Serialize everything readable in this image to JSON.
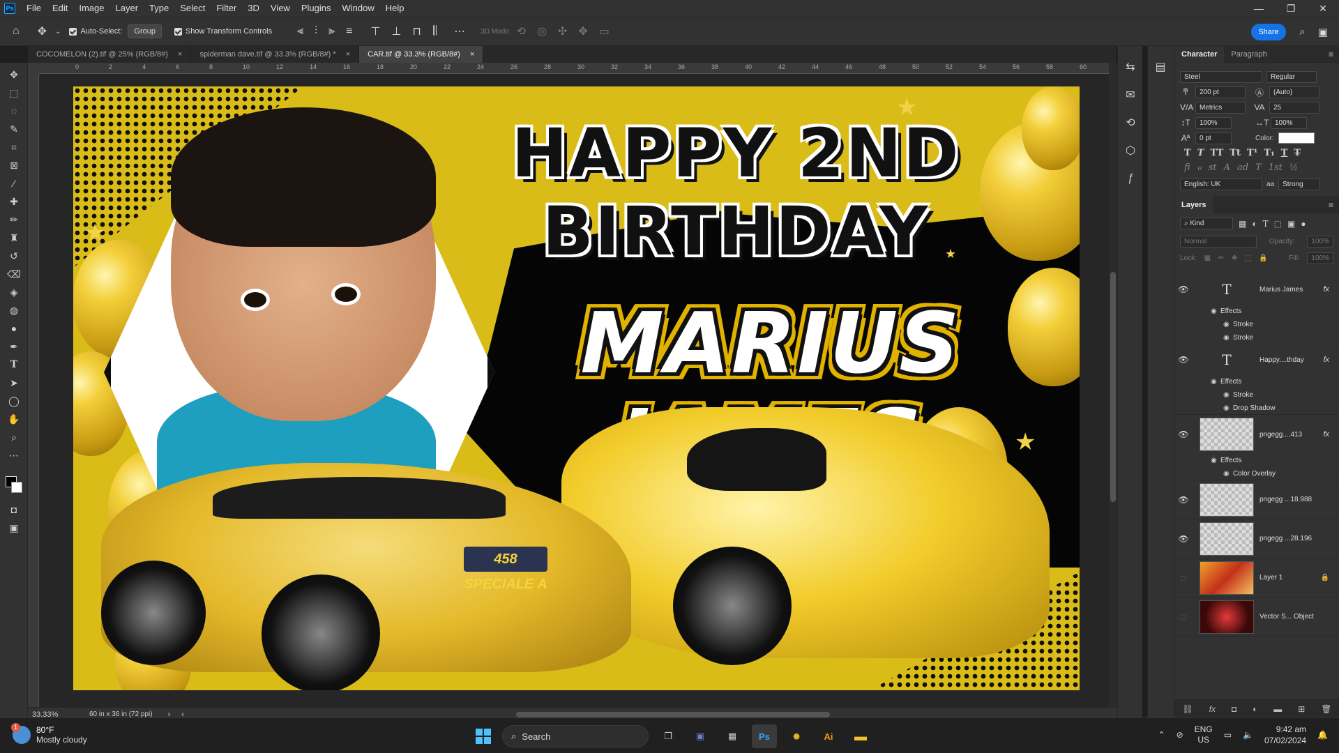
{
  "app": {
    "menu": [
      "File",
      "Edit",
      "Image",
      "Layer",
      "Type",
      "Select",
      "Filter",
      "3D",
      "View",
      "Plugins",
      "Window",
      "Help"
    ],
    "window_controls": [
      "—",
      "❐",
      "✕"
    ]
  },
  "options_bar": {
    "auto_select_label": "Auto-Select:",
    "auto_select_value": "Group",
    "show_transform_label": "Show Transform Controls",
    "mode_3d": "3D Mode:",
    "share_label": "Share"
  },
  "tabs": [
    {
      "label": "COCOMELON (2).tif @ 25% (RGB/8#)",
      "close": "×"
    },
    {
      "label": "spiderman dave.tif @ 33.3% (RGB/8#) *",
      "close": "×"
    },
    {
      "label": "CAR.tif @ 33.3% (RGB/8#)",
      "close": "×"
    }
  ],
  "ruler": {
    "ticks": [
      "0",
      "2",
      "4",
      "6",
      "8",
      "10",
      "12",
      "14",
      "16",
      "18",
      "20",
      "22",
      "24",
      "26",
      "28",
      "30",
      "32",
      "34",
      "36",
      "38",
      "40",
      "42",
      "44",
      "46",
      "48",
      "50",
      "52",
      "54",
      "56",
      "58",
      "60"
    ]
  },
  "canvas": {
    "title_text": "HAPPY 2ND BIRTHDAY",
    "name_text": "MARIUS JAMES",
    "plate_text": "458 SPECIALE A"
  },
  "status": {
    "zoom": "33.33%",
    "doc_info": "60 in x 36 in (72 ppi)"
  },
  "character_panel": {
    "tabs": [
      "Character",
      "Paragraph"
    ],
    "font_family": "Steel",
    "font_style": "Regular",
    "size": "200 pt",
    "leading": "(Auto)",
    "kerning": "Metrics",
    "tracking": "25",
    "vscale": "100%",
    "hscale": "100%",
    "baseline": "0 pt",
    "color_label": "Color:",
    "text_color": "#ffffff",
    "type_buttons": [
      "T",
      "T",
      "TT",
      "Tt",
      "T¹",
      "T₁",
      "T",
      "T"
    ],
    "opentype_buttons": [
      "fi",
      "ℴ",
      "st",
      "A",
      "ad",
      "T",
      "1st",
      "½"
    ],
    "language": "English: UK",
    "aa_label": "aa",
    "antialias": "Strong"
  },
  "layers_panel": {
    "title": "Layers",
    "filter_kind": "Kind",
    "blend_mode": "Normal",
    "opacity_label": "Opacity:",
    "opacity_value": "100%",
    "lock_label": "Lock:",
    "fill_label": "Fill:",
    "fill_value": "100%",
    "layers": [
      {
        "name": "Marius James",
        "kind": "text",
        "fx": "fx",
        "effects_label": "Effects",
        "effects": [
          "Stroke",
          "Stroke"
        ]
      },
      {
        "name": "Happy....thday",
        "kind": "text",
        "fx": "fx",
        "effects_label": "Effects",
        "effects": [
          "Stroke",
          "Drop Shadow"
        ]
      },
      {
        "name": "pngegg....413",
        "kind": "image",
        "fx": "fx",
        "effects_label": "Effects",
        "effects": [
          "Color Overlay"
        ]
      },
      {
        "name": "pngegg ...18.988",
        "kind": "image"
      },
      {
        "name": "pngegg ...28.196",
        "kind": "image"
      },
      {
        "name": "Layer 1",
        "kind": "image",
        "lock": "🔒"
      },
      {
        "name": "Vector S... Object",
        "kind": "image"
      }
    ]
  },
  "taskbar": {
    "weather_temp": "80°F",
    "weather_desc": "Mostly cloudy",
    "weather_badge": "1",
    "search_label": "Search",
    "lang_top": "ENG",
    "lang_bottom": "US",
    "time": "9:42 am",
    "date": "07/02/2024",
    "apps": [
      "Ps",
      "●",
      "Ai",
      "▬"
    ]
  }
}
